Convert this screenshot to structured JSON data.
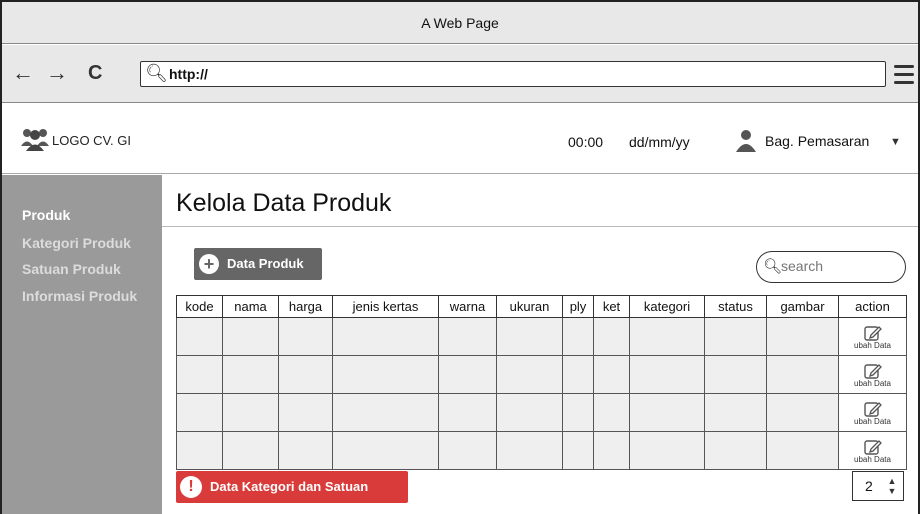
{
  "window": {
    "title": "A Web Page"
  },
  "browser": {
    "back": "←",
    "forward": "→",
    "reload": "C",
    "url": "http://"
  },
  "header": {
    "logo_text": "LOGO CV. GI",
    "time": "00:00",
    "date": "dd/mm/yy",
    "user": "Bag. Pemasaran"
  },
  "sidebar": {
    "items": [
      {
        "label": "Produk"
      },
      {
        "label": "Kategori Produk"
      },
      {
        "label": "Satuan Produk"
      },
      {
        "label": "Informasi Produk"
      }
    ]
  },
  "main": {
    "title": "Kelola Data Produk",
    "add_button": "Data Produk",
    "search_placeholder": "search",
    "table": {
      "columns": [
        "kode",
        "nama",
        "harga",
        "jenis kertas",
        "warna",
        "ukuran",
        "ply",
        "ket",
        "kategori",
        "status",
        "gambar",
        "action"
      ],
      "row_action_label": "ubah Data",
      "rows": 4
    },
    "bottom_button": "Data Kategori dan Satuan",
    "page_number": "2"
  }
}
